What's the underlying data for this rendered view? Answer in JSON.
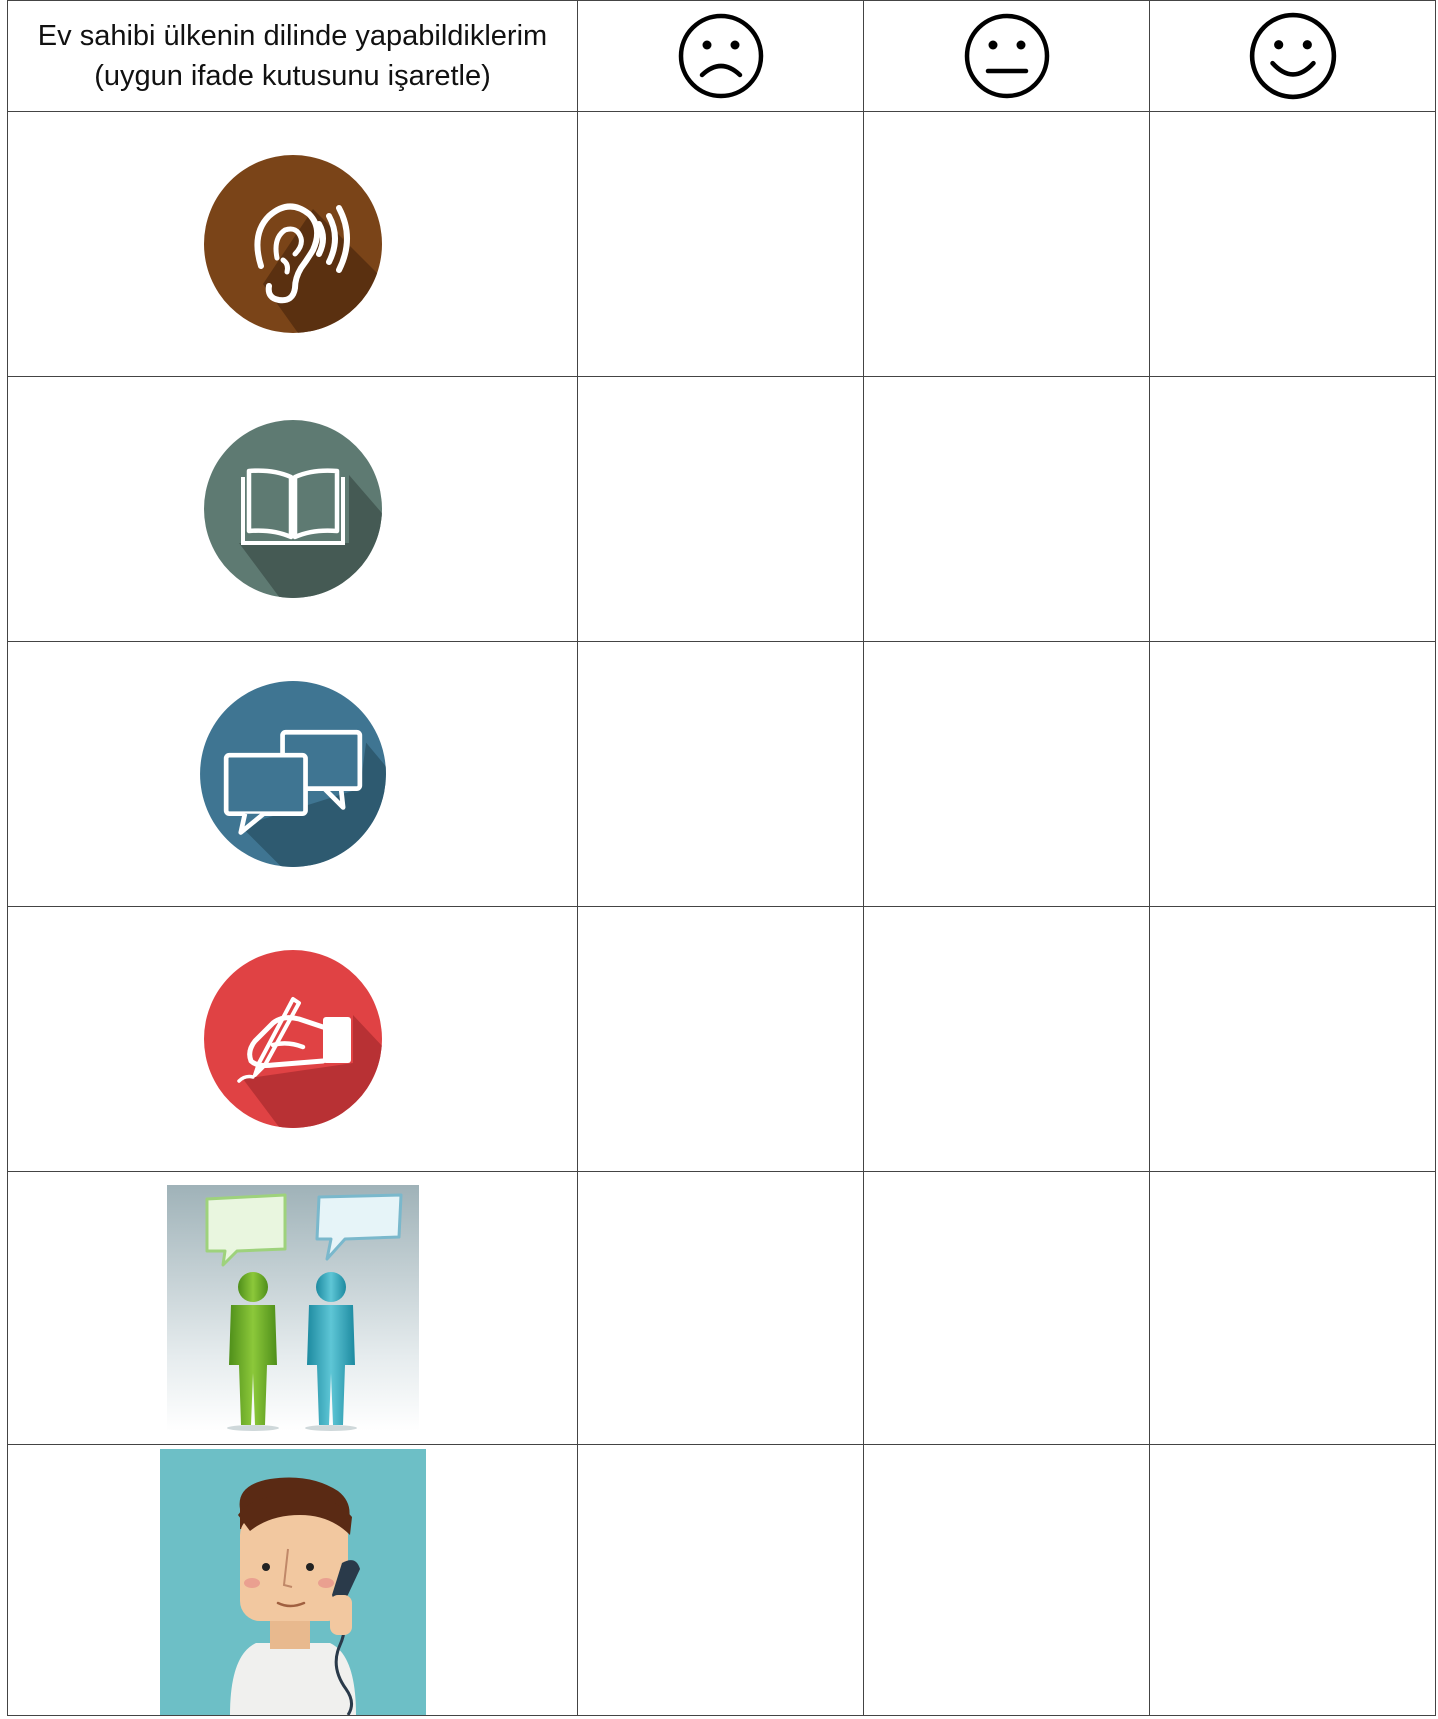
{
  "header": {
    "line1": "Ev sahibi ülkenin dilinde yapabildiklerim",
    "line2": "(uygun ifade kutusunu işaretle)",
    "faces": [
      {
        "icon": "sad-face-icon"
      },
      {
        "icon": "neutral-face-icon"
      },
      {
        "icon": "happy-face-icon"
      }
    ]
  },
  "rows": [
    {
      "icon": "listening-ear-icon",
      "color": "#7a4418"
    },
    {
      "icon": "open-book-icon",
      "color": "#5e7a72"
    },
    {
      "icon": "speech-bubbles-icon",
      "color": "#3f7592"
    },
    {
      "icon": "writing-hand-icon",
      "color": "#e04244"
    },
    {
      "icon": "people-talking-icon",
      "color": "#76b82a"
    },
    {
      "icon": "man-on-phone-icon",
      "color": "#6dbfc6"
    }
  ]
}
